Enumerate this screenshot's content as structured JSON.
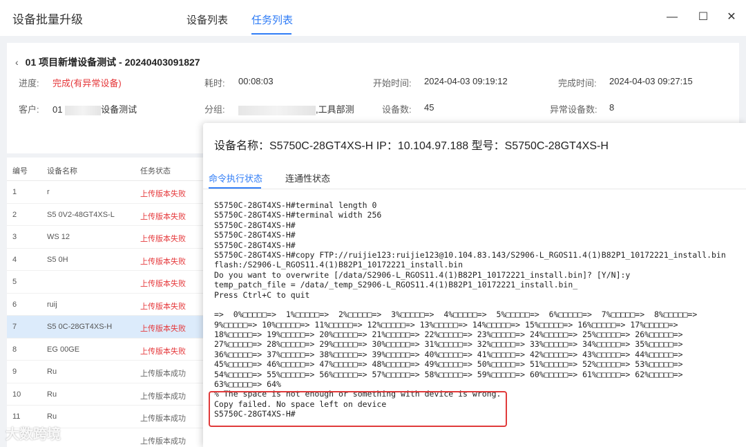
{
  "app": {
    "title": "设备批量升级",
    "tabs": [
      "设备列表",
      "任务列表"
    ],
    "window_controls": {
      "close": "✕",
      "maximize": "☐",
      "minimize": "—"
    }
  },
  "task": {
    "back_icon": "chevron-left-icon",
    "title": "01 项目新增设备测试 - 20240403091827",
    "progress_label": "进度:",
    "progress_value": "完成(有异常设备)",
    "duration_label": "耗时:",
    "duration_value": "00:08:03",
    "start_label": "开始时间:",
    "start_value": "2024-04-03 09:19:12",
    "end_label": "完成时间:",
    "end_value": "2024-04-03 09:27:15",
    "customer_label": "客户:",
    "customer_prefix": "01",
    "customer_suffix": "设备测试",
    "group_label": "分组:",
    "group_suffix": ",工具部测",
    "device_count_label": "设备数:",
    "device_count_value": "45",
    "abnormal_label": "异常设备数:",
    "abnormal_value": "8"
  },
  "table": {
    "headers": [
      "编号",
      "设备名称",
      "任务状态"
    ],
    "rows": [
      {
        "no": "1",
        "name": "r",
        "status": "上传版本失败",
        "state": "fail"
      },
      {
        "no": "2",
        "name": "S5  0V2-48GT4XS-L",
        "status": "上传版本失败",
        "state": "fail"
      },
      {
        "no": "3",
        "name": "WS  12",
        "status": "上传版本失败",
        "state": "fail"
      },
      {
        "no": "4",
        "name": "S5  0H",
        "status": "上传版本失败",
        "state": "fail"
      },
      {
        "no": "5",
        "name": "",
        "status": "上传版本失败",
        "state": "fail"
      },
      {
        "no": "6",
        "name": "ruij",
        "status": "上传版本失败",
        "state": "fail"
      },
      {
        "no": "7",
        "name": "S5  0C-28GT4XS-H",
        "status": "上传版本失败",
        "state": "fail"
      },
      {
        "no": "8",
        "name": "EG  00GE",
        "status": "上传版本失败",
        "state": "fail"
      },
      {
        "no": "9",
        "name": "Ru",
        "status": "上传版本成功",
        "state": "ok"
      },
      {
        "no": "10",
        "name": "Ru",
        "status": "上传版本成功",
        "state": "ok"
      },
      {
        "no": "11",
        "name": "Ru",
        "status": "上传版本成功",
        "state": "ok"
      },
      {
        "no": "",
        "name": "",
        "status": "上传版本成功",
        "state": "ok"
      }
    ]
  },
  "dialog": {
    "title": "设备名称：S5750C-28GT4XS-H IP：10.104.97.188 型号：S5750C-28GT4XS-H",
    "tabs": [
      "命令执行状态",
      "连通性状态"
    ],
    "console_lines": [
      "S5750C-28GT4XS-H#terminal length 0",
      "S5750C-28GT4XS-H#terminal width 256",
      "S5750C-28GT4XS-H#",
      "S5750C-28GT4XS-H#",
      "S5750C-28GT4XS-H#",
      "S5750C-28GT4XS-H#copy FTP://ruijie123:ruijie123@10.104.83.143/S2906-L_RGOS11.4(1)B82P1_10172221_install.bin",
      "flash:/S2906-L_RGOS11.4(1)B82P1_10172221_install.bin",
      "Do you want to overwrite [/data/S2906-L_RGOS11.4(1)B82P1_10172221_install.bin]? [Y/N]:y",
      "temp_patch_file = /data/_temp_S2906-L_RGOS11.4(1)B82P1_10172221_install.bin_",
      "Press Ctrl+C to quit",
      "",
      "=>  0%□□□□□=>  1%□□□□□=>  2%□□□□□=>  3%□□□□□=>  4%□□□□□=>  5%□□□□□=>  6%□□□□□=>  7%□□□□□=>  8%□□□□□=>",
      "9%□□□□□=> 10%□□□□□=> 11%□□□□□=> 12%□□□□□=> 13%□□□□□=> 14%□□□□□=> 15%□□□□□=> 16%□□□□□=> 17%□□□□□=>",
      "18%□□□□□=> 19%□□□□□=> 20%□□□□□=> 21%□□□□□=> 22%□□□□□=> 23%□□□□□=> 24%□□□□□=> 25%□□□□□=> 26%□□□□□=>",
      "27%□□□□□=> 28%□□□□□=> 29%□□□□□=> 30%□□□□□=> 31%□□□□□=> 32%□□□□□=> 33%□□□□□=> 34%□□□□□=> 35%□□□□□=>",
      "36%□□□□□=> 37%□□□□□=> 38%□□□□□=> 39%□□□□□=> 40%□□□□□=> 41%□□□□□=> 42%□□□□□=> 43%□□□□□=> 44%□□□□□=>",
      "45%□□□□□=> 46%□□□□□=> 47%□□□□□=> 48%□□□□□=> 49%□□□□□=> 50%□□□□□=> 51%□□□□□=> 52%□□□□□=> 53%□□□□□=>",
      "54%□□□□□=> 55%□□□□□=> 56%□□□□□=> 57%□□□□□=> 58%□□□□□=> 59%□□□□□=> 60%□□□□□=> 61%□□□□□=> 62%□□□□□=>",
      "63%□□□□□=> 64%",
      "% The space is not enough or something with device is wrong.",
      "Copy failed. No space left on device",
      "S5750C-28GT4XS-H#"
    ]
  },
  "watermark": "大数跨境",
  "colors": {
    "accent": "#2f7cf6",
    "error": "#e5383b",
    "error_box": "#e03a3a",
    "selected_row": "#dcebfb"
  }
}
